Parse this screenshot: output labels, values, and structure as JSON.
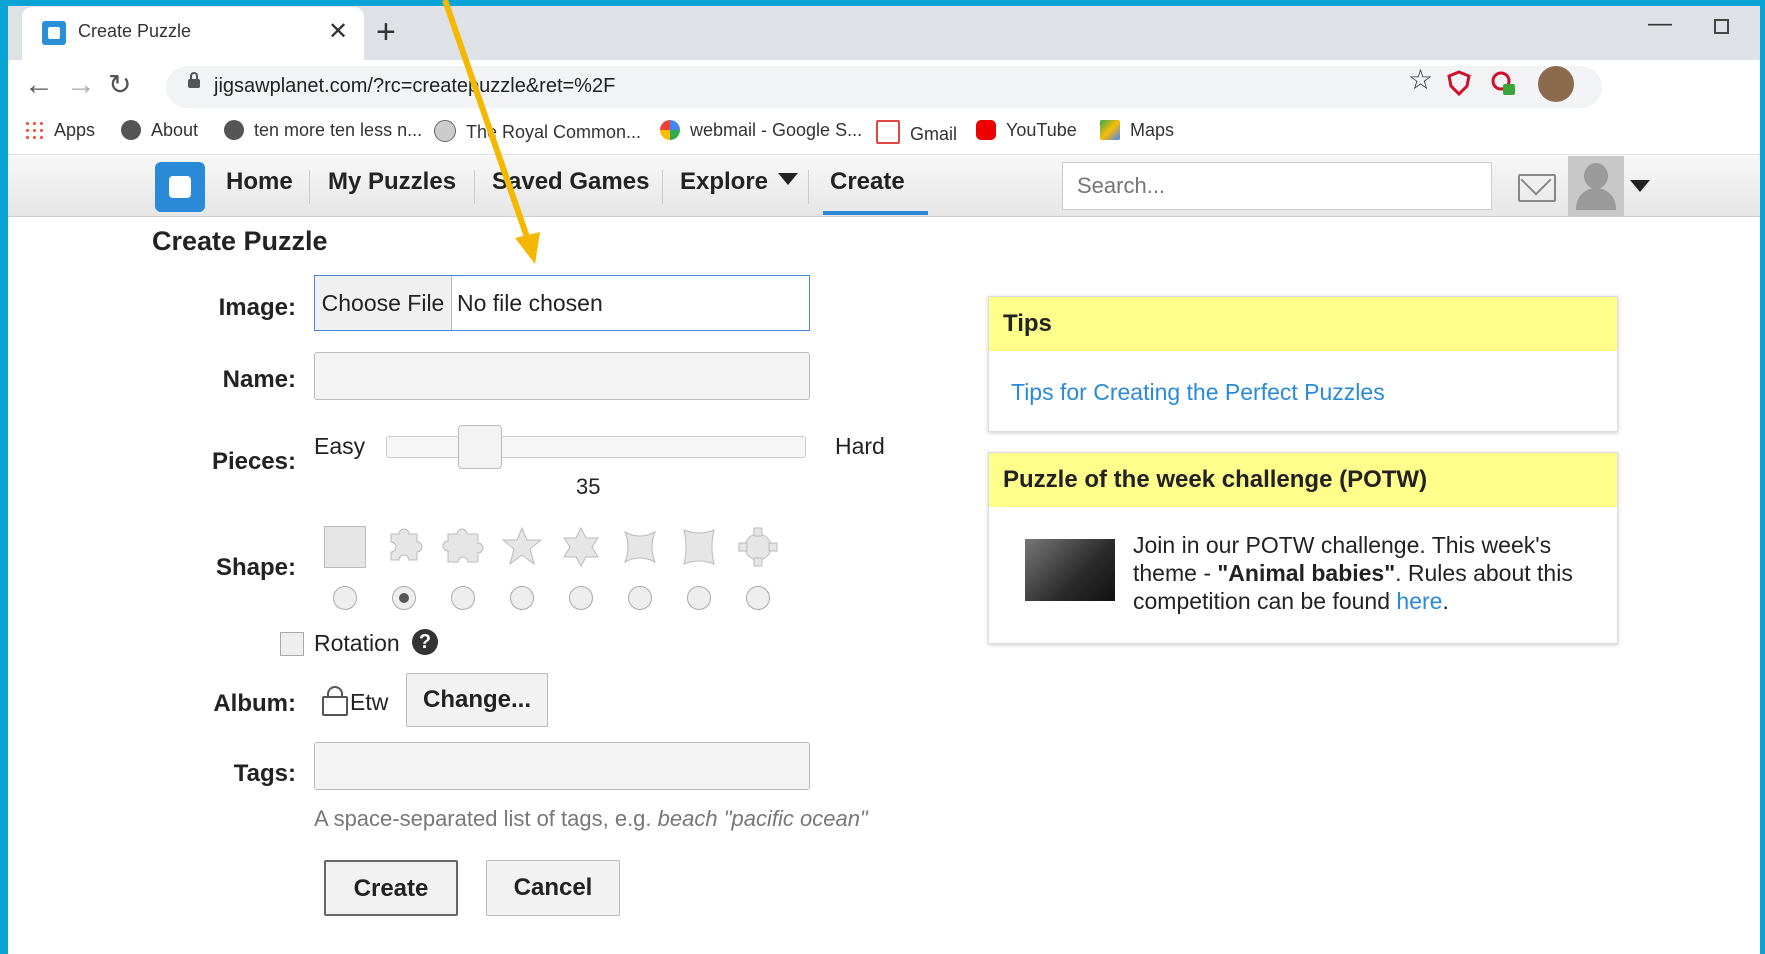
{
  "browser": {
    "tab_title": "Create Puzzle",
    "url": "jigsawplanet.com/?rc=createpuzzle&ret=%2F",
    "bookmarks": [
      "Apps",
      "About",
      "ten more ten less n...",
      "The Royal Common...",
      "webmail - Google S...",
      "Gmail",
      "YouTube",
      "Maps"
    ],
    "extension_badge": "1"
  },
  "site_nav": {
    "items": [
      "Home",
      "My Puzzles",
      "Saved Games",
      "Explore",
      "Create"
    ],
    "active": "Create",
    "search_placeholder": "Search..."
  },
  "form": {
    "title": "Create Puzzle",
    "image_label": "Image:",
    "choose_file": "Choose File",
    "no_file": "No file chosen",
    "name_label": "Name:",
    "pieces_label": "Pieces:",
    "easy": "Easy",
    "hard": "Hard",
    "pieces_value": "35",
    "pieces_fraction": 0.2,
    "shape_label": "Shape:",
    "shapes": [
      "square",
      "classic",
      "irregular",
      "star",
      "hex",
      "round",
      "tile",
      "gear"
    ],
    "selected_shape": 1,
    "rotation_label": "Rotation",
    "album_label": "Album:",
    "album_name": "Etw",
    "change_button": "Change...",
    "tags_label": "Tags:",
    "tags_hint_prefix": "A space-separated list of tags, e.g. ",
    "tags_hint_example": "beach \"pacific ocean\"",
    "create_button": "Create",
    "cancel_button": "Cancel"
  },
  "tips": {
    "heading": "Tips",
    "link": "Tips for Creating the Perfect Puzzles"
  },
  "potw": {
    "heading": "Puzzle of the week challenge (POTW)",
    "text1": "Join in our POTW challenge. This week's theme - ",
    "theme": "\"Animal babies\"",
    "text2": ". Rules about this competition can be found ",
    "link": "here",
    "text3": "."
  },
  "colors": {
    "accent": "#2b8ad8",
    "panel_header": "#fffe8a",
    "arrow": "#f5b800"
  }
}
